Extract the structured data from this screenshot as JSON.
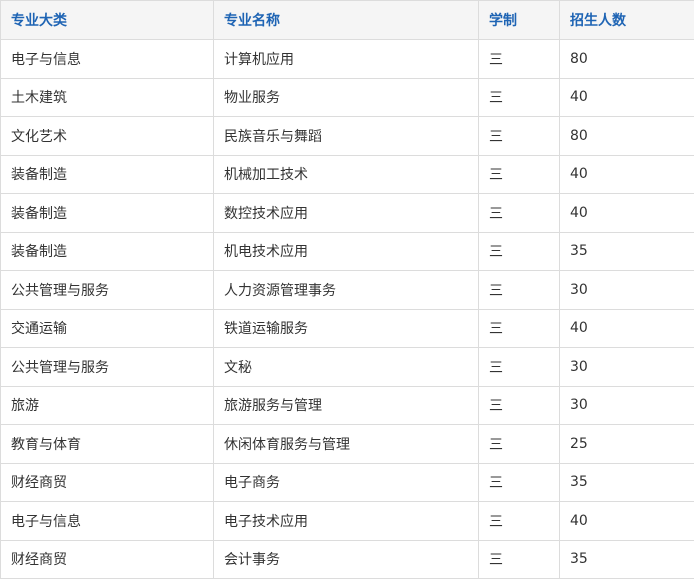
{
  "table": {
    "headers": [
      "专业大类",
      "专业名称",
      "学制",
      "招生人数"
    ],
    "rows": [
      [
        "电子与信息",
        "计算机应用",
        "三",
        "80"
      ],
      [
        "土木建筑",
        "物业服务",
        "三",
        "40"
      ],
      [
        "文化艺术",
        "民族音乐与舞蹈",
        "三",
        "80"
      ],
      [
        "装备制造",
        "机械加工技术",
        "三",
        "40"
      ],
      [
        "装备制造",
        "数控技术应用",
        "三",
        "40"
      ],
      [
        "装备制造",
        "机电技术应用",
        "三",
        "35"
      ],
      [
        "公共管理与服务",
        "人力资源管理事务",
        "三",
        "30"
      ],
      [
        "交通运输",
        "铁道运输服务",
        "三",
        "40"
      ],
      [
        "公共管理与服务",
        "文秘",
        "三",
        "30"
      ],
      [
        "旅游",
        "旅游服务与管理",
        "三",
        "30"
      ],
      [
        "教育与体育",
        "休闲体育服务与管理",
        "三",
        "25"
      ],
      [
        "财经商贸",
        "电子商务",
        "三",
        "35"
      ],
      [
        "电子与信息",
        "电子技术应用",
        "三",
        "40"
      ],
      [
        "财经商贸",
        "会计事务",
        "三",
        "35"
      ]
    ]
  },
  "colors": {
    "header_text": "#1e64b4",
    "header_bg": "#f5f5f5",
    "border": "#dcdcdc",
    "body_text": "#333333"
  }
}
